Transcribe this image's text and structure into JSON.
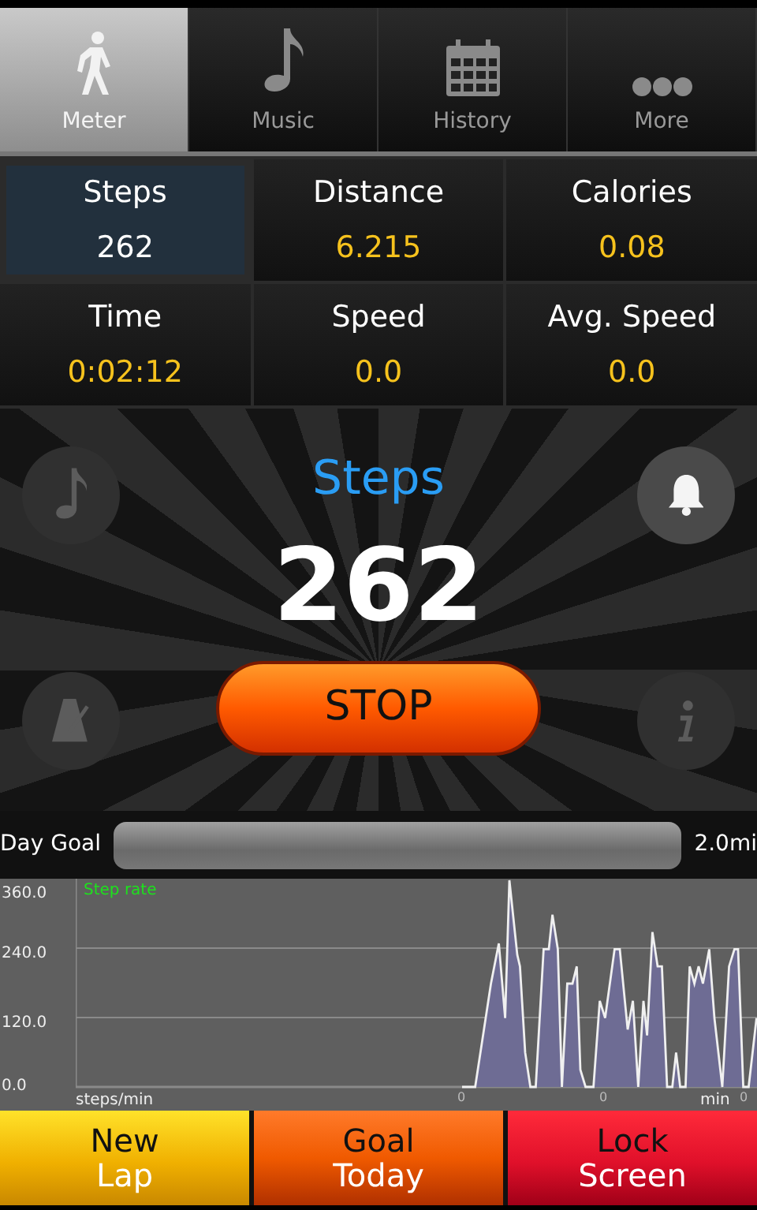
{
  "tabs": [
    {
      "label": "Meter",
      "selected": true
    },
    {
      "label": "Music",
      "selected": false
    },
    {
      "label": "History",
      "selected": false
    },
    {
      "label": "More",
      "selected": false
    }
  ],
  "stats": [
    {
      "label": "Steps",
      "value": "262",
      "selected": true
    },
    {
      "label": "Distance",
      "value": "6.215",
      "selected": false
    },
    {
      "label": "Calories",
      "value": "0.08",
      "selected": false
    },
    {
      "label": "Time",
      "value": "0:02:12",
      "selected": false
    },
    {
      "label": "Speed",
      "value": "0.0",
      "selected": false
    },
    {
      "label": "Avg. Speed",
      "value": "0.0",
      "selected": false
    }
  ],
  "meter": {
    "title": "Steps",
    "count": "262",
    "stop_button": "STOP",
    "side_buttons": [
      {
        "enabled": false
      },
      {
        "enabled": true
      },
      {
        "enabled": false
      },
      {
        "enabled": false
      }
    ]
  },
  "day_goal": {
    "label": "Day Goal",
    "target": "2.0mi"
  },
  "graph": {
    "legend": "Step rate",
    "y_tick_labels": [
      "360.0",
      "240.0",
      "120.0",
      "0.0"
    ],
    "y_unit": "steps/min",
    "x_tick_labels": [
      "0",
      "0",
      "0"
    ],
    "x_unit": "min"
  },
  "actions": [
    {
      "line1": "New",
      "line2": "Lap",
      "kind": "yellow"
    },
    {
      "line1": "Goal",
      "line2": "Today",
      "kind": "orange"
    },
    {
      "line1": "Lock",
      "line2": "Screen",
      "kind": "red"
    }
  ]
}
